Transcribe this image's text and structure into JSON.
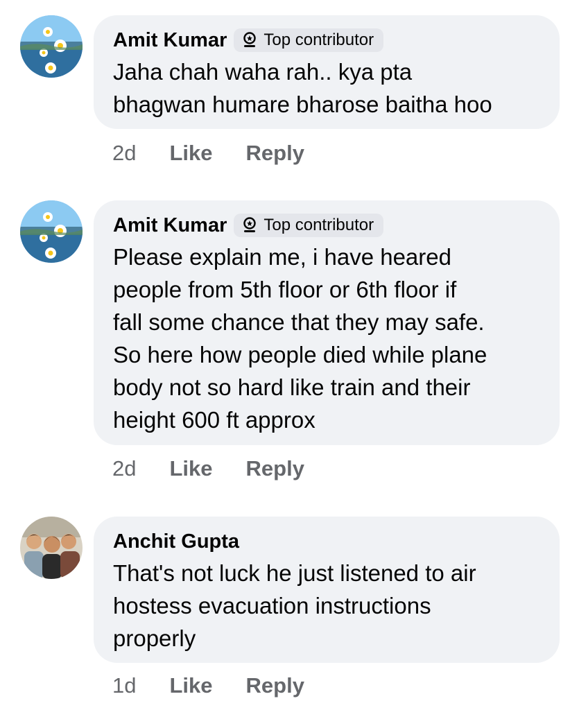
{
  "comments": [
    {
      "author": "Amit Kumar",
      "badge": "Top contributor",
      "badge_icon": "top-contributor-icon",
      "lines": [
        "Jaha chah waha rah.. kya pta",
        "bhagwan humare bharose baitha hoo"
      ],
      "time": "2d",
      "like_label": "Like",
      "reply_label": "Reply"
    },
    {
      "author": "Amit Kumar",
      "badge": "Top contributor",
      "badge_icon": "top-contributor-icon",
      "lines": [
        "Please explain me, i have heared",
        "people from 5th floor or 6th floor if",
        "fall some chance that they may safe.",
        "So here how people died while plane",
        "body not so hard like train and their",
        "height 600 ft approx"
      ],
      "time": "2d",
      "like_label": "Like",
      "reply_label": "Reply"
    },
    {
      "author": "Anchit Gupta",
      "lines": [
        "That's not luck he just listened to air",
        "hostess evacuation instructions",
        "properly"
      ],
      "time": "1d",
      "like_label": "Like",
      "reply_label": "Reply"
    }
  ],
  "colors": {
    "bubble": "#f0f2f5",
    "badge": "#e4e6eb",
    "meta_text": "#65676b",
    "body_text": "#050505"
  }
}
